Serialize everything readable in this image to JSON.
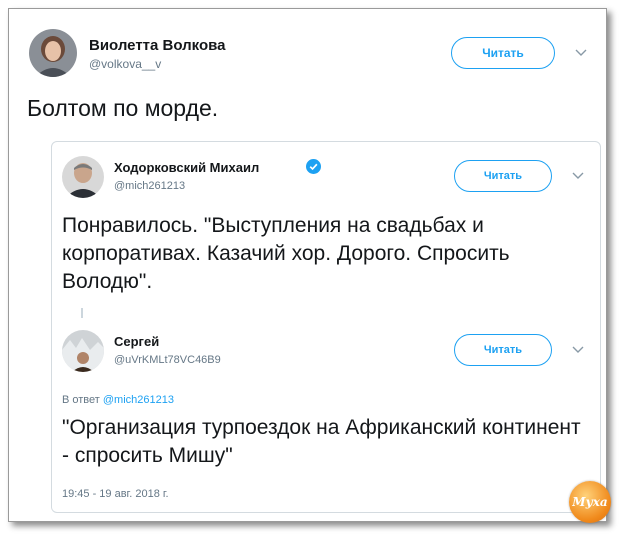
{
  "main_tweet": {
    "author_name": "Виолетта Волкова",
    "author_handle": "@volkova__v",
    "follow_label": "Читать",
    "text": "Болтом по морде."
  },
  "quoted_tweet": {
    "author_name": "Ходорковский Михаил",
    "author_handle": "@mich261213",
    "verified": true,
    "follow_label": "Читать",
    "text": "Понравилось. \"Выступления на свадьбах и корпоративах. Казачий хор. Дорого. Спросить Володю\"."
  },
  "reply_tweet": {
    "author_name": "Сергей",
    "author_handle": "@uVrKMLt78VC46B9",
    "follow_label": "Читать",
    "reply_to_prefix": "В ответ",
    "reply_to_handle": "@mich261213",
    "text": "\"Организация турпоездок на Африканский континент - спросить Мишу\"",
    "timestamp": "19:45 - 19 авг. 2018 г."
  },
  "watermark_text": "Муха",
  "colors": {
    "accent": "#1da1f2",
    "secondary_text": "#657786",
    "border": "#d4dbe0"
  }
}
